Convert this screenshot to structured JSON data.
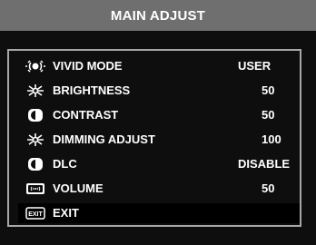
{
  "menu": {
    "title": "MAIN ADJUST",
    "items": [
      {
        "label": "VIVID MODE",
        "value": "USER",
        "icon": "vivid-mode-icon"
      },
      {
        "label": "BRIGHTNESS",
        "value": "50",
        "icon": "brightness-icon"
      },
      {
        "label": "CONTRAST",
        "value": "50",
        "icon": "contrast-icon"
      },
      {
        "label": "DIMMING ADJUST",
        "value": "100",
        "icon": "dimming-icon"
      },
      {
        "label": "DLC",
        "value": "DISABLE",
        "icon": "dlc-icon"
      },
      {
        "label": "VOLUME",
        "value": "50",
        "icon": "volume-icon"
      },
      {
        "label": "EXIT",
        "icon": "exit-icon",
        "icon_text": "EXIT"
      }
    ]
  },
  "colors": {
    "background": "#0e0e0e",
    "header": "#6f6f6f",
    "frame_border": "#a7a7a7",
    "text": "#ffffff"
  }
}
